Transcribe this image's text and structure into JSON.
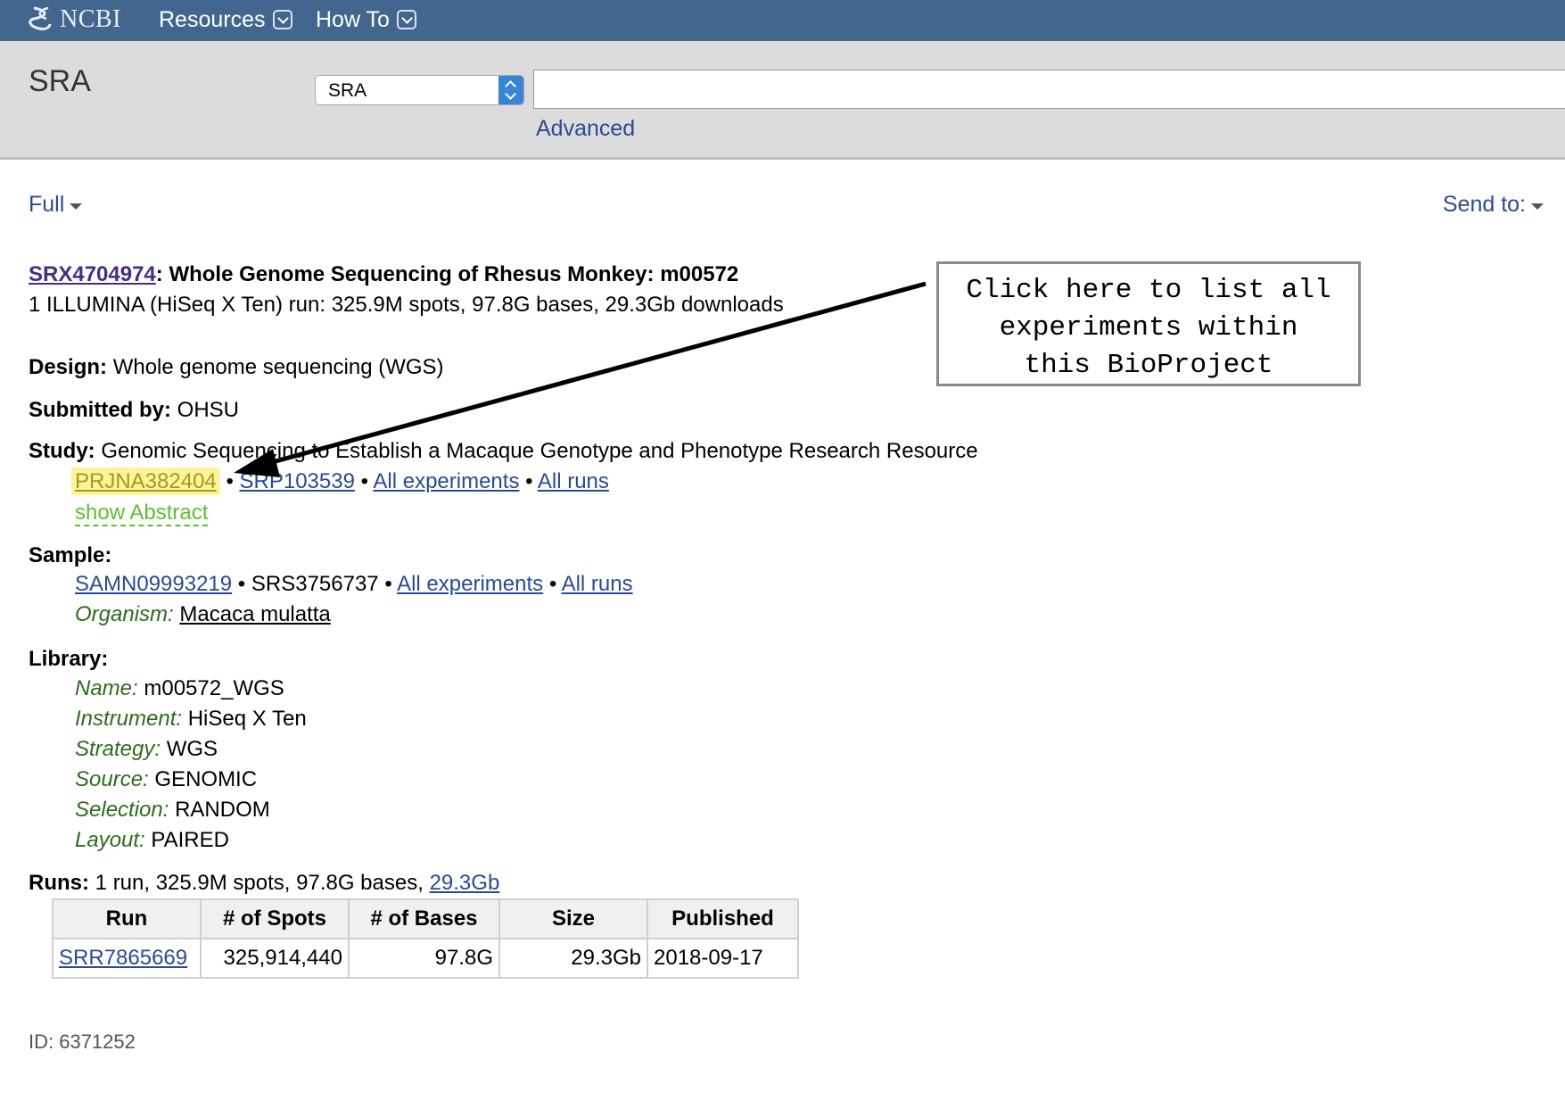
{
  "nav": {
    "logo_text": "NCBI",
    "items": [
      {
        "label": "Resources"
      },
      {
        "label": "How To"
      }
    ]
  },
  "search": {
    "db_title": "SRA",
    "db_selected": "SRA",
    "term_value": "",
    "advanced_label": "Advanced"
  },
  "format": {
    "display_label": "Full",
    "send_to_label": "Send to:"
  },
  "record": {
    "accession": "SRX4704974",
    "title_sep": ":",
    "title": "Whole Genome Sequencing of Rhesus Monkey: m00572",
    "summary": "1 ILLUMINA (HiSeq X Ten) run: 325.9M spots, 97.8G bases, 29.3Gb downloads",
    "design_label": "Design:",
    "design_value": "Whole genome sequencing (WGS)",
    "submitted_label": "Submitted by:",
    "submitted_value": "OHSU",
    "study_label": "Study:",
    "study_value": "Genomic Sequencing to Establish a Macaque Genotype and Phenotype Research Resource",
    "bioproject": "PRJNA382404",
    "srp": "SRP103539",
    "all_experiments": "All experiments",
    "all_runs": "All runs",
    "show_abstract": "show Abstract",
    "bullet": "•",
    "sample_label": "Sample:",
    "biosample": "SAMN09993219",
    "srs": "SRS3756737",
    "organism_label": "Organism:",
    "organism_value": "Macaca mulatta",
    "library_label": "Library:",
    "library": [
      {
        "label": "Name:",
        "value": "m00572_WGS"
      },
      {
        "label": "Instrument:",
        "value": "HiSeq X Ten"
      },
      {
        "label": "Strategy:",
        "value": "WGS"
      },
      {
        "label": "Source:",
        "value": "GENOMIC"
      },
      {
        "label": "Selection:",
        "value": "RANDOM"
      },
      {
        "label": "Layout:",
        "value": "PAIRED"
      }
    ],
    "runs_label": "Runs:",
    "runs_summary": "1 run, 325.9M spots, 97.8G bases,",
    "runs_size_link": "29.3Gb"
  },
  "runs_table": {
    "headers": [
      "Run",
      "# of Spots",
      "# of Bases",
      "Size",
      "Published"
    ],
    "rows": [
      {
        "run": "SRR7865669",
        "spots": "325,914,440",
        "bases": "97.8G",
        "size": "29.3Gb",
        "published": "2018-09-17"
      }
    ]
  },
  "uid": "ID: 6371252",
  "annotation": {
    "lines": [
      "Click here to list all",
      "experiments within",
      "this BioProject"
    ]
  }
}
